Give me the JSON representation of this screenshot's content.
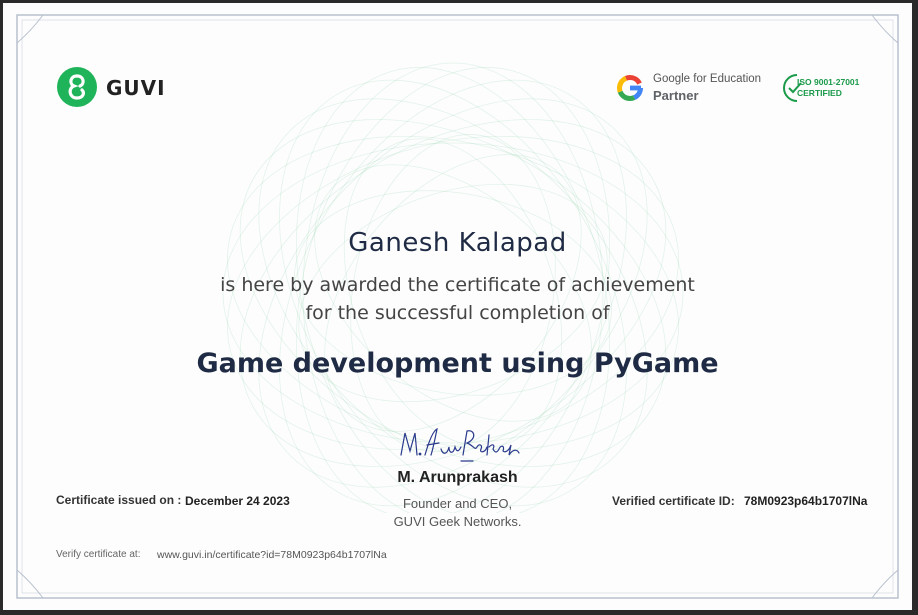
{
  "brand": {
    "name": "GUVI"
  },
  "partner": {
    "line1": "Google for Education",
    "line2": "Partner"
  },
  "iso": {
    "line1": "ISO 9001-27001",
    "line2": "CERTIFIED"
  },
  "recipient": {
    "name": "Ganesh Kalapad"
  },
  "award": {
    "line1": "is here by awarded the certificate of achievement",
    "line2": "for the successful completion of"
  },
  "course": {
    "title": "Game development using PyGame"
  },
  "signatory": {
    "signature_text": "M. Arunprakash",
    "name": "M. Arunprakash",
    "role": "Founder and CEO,",
    "org": "GUVI Geek Networks."
  },
  "issue": {
    "label": "Certificate issued on :",
    "date": "December 24 2023"
  },
  "verification": {
    "id_label": "Verified certificate ID:",
    "id": "78M0923p64b1707lNa",
    "verify_label": "Verify certificate at:",
    "url": "www.guvi.in/certificate?id=78M0923p64b1707lNa"
  },
  "colors": {
    "brand_green": "#1fb45a",
    "navy": "#1f2a44",
    "frame": "#b9c1cf"
  }
}
